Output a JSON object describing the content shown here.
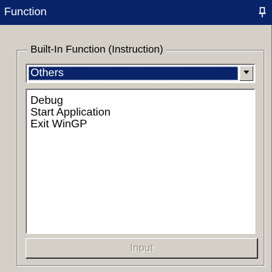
{
  "window": {
    "title": "Function",
    "pin_icon": "pushpin-icon"
  },
  "group": {
    "label": "Built-In Function (Instruction)"
  },
  "dropdown": {
    "selected": "Others",
    "arrow_icon": "chevron-down-icon"
  },
  "list": {
    "items": [
      "Debug",
      "Start Application",
      "Exit WinGP"
    ]
  },
  "input_button": {
    "label": "Input",
    "disabled": true
  },
  "colors": {
    "titlebar": "#0a246a",
    "panel": "#d4d0c8",
    "selection": "#0a246a"
  }
}
